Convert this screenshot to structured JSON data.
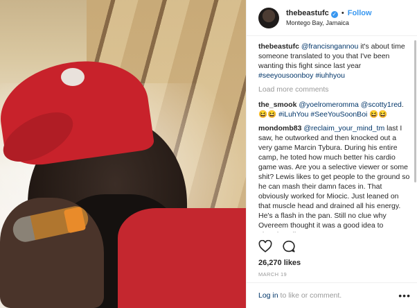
{
  "photo": {
    "description_icon": "photo-icon"
  },
  "header": {
    "username": "thebeastufc",
    "verified_glyph": "✓",
    "separator": "•",
    "follow_label": "Follow",
    "location": "Montego Bay, Jamaica"
  },
  "caption": {
    "user": "thebeastufc",
    "mention": "@francisngannou",
    "text": " it's about time someone translated to you that I've been wanting this fight since last year ",
    "tags": "#seeyousoonboy #iuhhyou"
  },
  "load_more_label": "Load more comments",
  "comments": [
    {
      "user": "the_smook",
      "parts": [
        "@yoelromeromma",
        " ",
        "@scotty1red",
        ". 😆😆 ",
        "#iLuhYou",
        " ",
        "#SeeYouSoonBoi",
        " 😆😆"
      ]
    },
    {
      "user": "mondomb83",
      "mention": "@reclaim_your_mind_tm",
      "text": " last I saw, he outworked and then knocked out a very game Marcin Tybura. During his entire camp, he toted how much better his cardio game was. Are you a selective viewer or some shit? Lewis likes to get people to the ground so he can mash their damn faces in. That obviously worked for Miocic. Just leaned on that muscle head and drained all his energy. He's a flash in the pan. Still no clue why Overeem thought it was a good idea to abandon all"
    }
  ],
  "likes": "26,270 likes",
  "date": "MARCH 19",
  "footer": {
    "login_link": "Log in",
    "login_rest": " to like or comment.",
    "more_glyph": "•••"
  }
}
